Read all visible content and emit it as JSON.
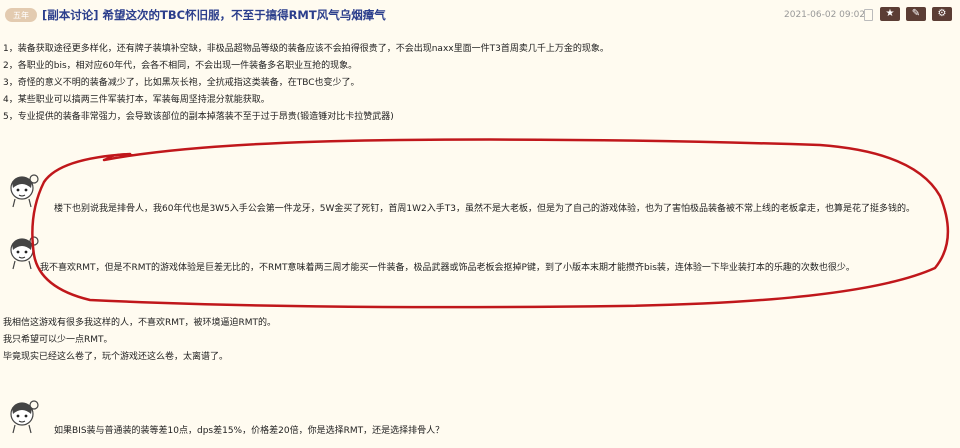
{
  "header": {
    "badge": "五年",
    "title": "[副本讨论] 希望这次的TBC怀旧服，不至于搞得RMT风气乌烟瘴气",
    "date": "2021-06-02 09:02",
    "buttons": [
      "★",
      "✎",
      "⚙"
    ]
  },
  "post": {
    "lines": [
      "1，装备获取途径更多样化，还有牌子装填补空缺，非极品超物品等级的装备应该不会拍得很贵了，不会出现naxx里面一件T3首周卖几千上万金的现象。",
      "2，各职业的bis，相对应60年代，会各不相同，不会出现一件装备多名职业互抢的现象。",
      "3，奇怪的意义不明的装备减少了，比如黑灰长袍，全抗戒指这类装备，在TBC也变少了。",
      "4，某些职业可以搞两三件军装打本，军装每周坚持混分就能获取。",
      "5，专业提供的装备非常强力，会导致该部位的副本掉落装不至于过于昂贵(锻造锤对比卡拉赞武器)"
    ]
  },
  "replies": [
    {
      "text": "楼下也别说我是排骨人，我60年代也是3W5入手公会第一件龙牙，5W金买了死钉，首周1W2入手T3，虽然不是大老板，但是为了自己的游戏体验，也为了害怕极品装备被不常上线的老板拿走，也算是花了挺多钱的。"
    },
    {
      "text": "我不喜欢RMT，但是不RMT的游戏体验是巨差无比的，不RMT意味着两三周才能买一件装备，极品武器或饰品老板会抠掉P键，到了小版本末期才能攒齐bis装，连体验一下毕业装打本的乐趣的次数也很少。"
    }
  ],
  "tail_lines": [
    "我相信这游戏有很多我这样的人，不喜欢RMT，被环境逼迫RMT的。",
    "我只希望可以少一点RMT。",
    "毕竟现实已经这么卷了，玩个游戏还这么卷，太离谱了。"
  ],
  "last_reply": {
    "text": "如果BIS装与普通装的装等差10点，dps差15%，价格差20倍，你是选择RMT，还是选择排骨人？"
  },
  "colors": {
    "background": "#fffbf0",
    "title": "#2b3e8c",
    "annotation": "#c0171b",
    "button": "#5b3d34"
  }
}
